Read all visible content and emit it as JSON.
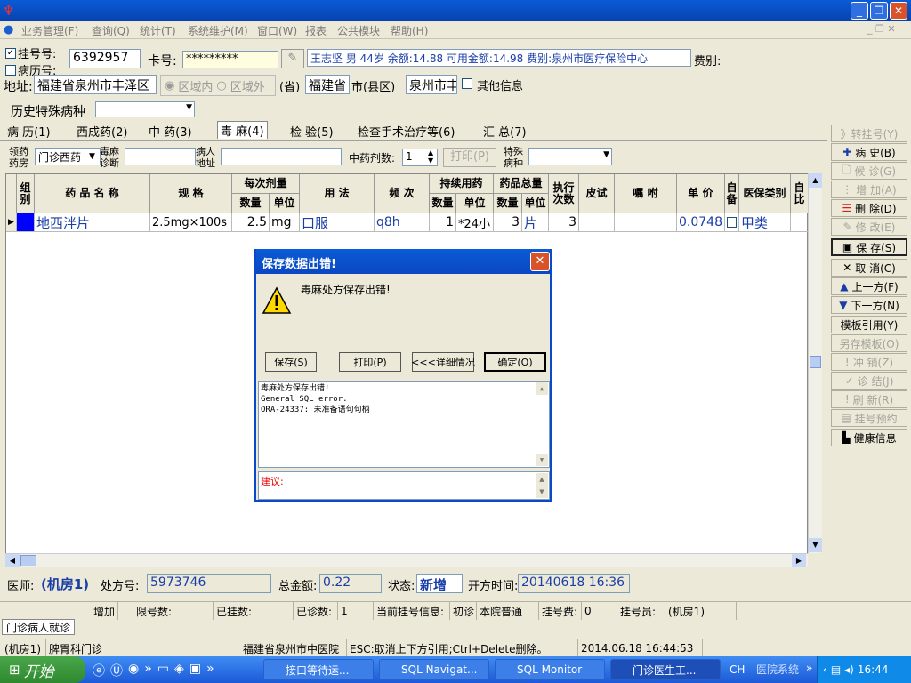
{
  "window": {
    "minimize": "_",
    "restore": "❐",
    "close": "✕"
  },
  "menu": [
    "业务管理(F)",
    "查询(Q)",
    "统计(T)",
    "系统维护(M)",
    "窗口(W)",
    "报表",
    "公共模块",
    "帮助(H)"
  ],
  "patient": {
    "reg_label": "挂号号:",
    "record_label": "病历号:",
    "reg_value": "6392957",
    "card_label": "卡号:",
    "card_value": "*********",
    "info": "王志坚 男 44岁 余额:14.88 可用金额:14.98 费别:泉州市医疗保险中心",
    "fee_type_label": "费别:",
    "addr_label": "地址:",
    "addr_value": "福建省泉州市丰泽区",
    "region_in": "区域内",
    "region_out": "区域外",
    "province_value": "福建省",
    "province_label": "(省)",
    "city_value": "泉州市丰",
    "city_label": "市(县区)",
    "other_info": "其他信息",
    "history_label": "历史特殊病种"
  },
  "tabs": [
    "病 历(1)",
    "西成药(2)",
    "中 药(3)",
    "毒 麻(4)",
    "检 验(5)",
    "检查手术治疗等(6)",
    "汇 总(7)"
  ],
  "rx_header": {
    "pharmacy_label": "领药药房",
    "pharmacy_value": "门诊西药",
    "diag_label": "毒麻诊断",
    "patient_addr_label": "病人地址",
    "herb_doses_label": "中药剂数:",
    "herb_doses_value": "1",
    "print_btn": "打印(P)",
    "special_label": "特殊病种"
  },
  "grid": {
    "headers": {
      "group": "组别",
      "name": "药 品 名 称",
      "spec": "规 格",
      "per_dose": "每次剂量",
      "qty": "数量",
      "unit": "单位",
      "usage": "用 法",
      "freq": "频 次",
      "duration": "持续用药",
      "total": "药品总量",
      "exec": "执行次数",
      "skin": "皮试",
      "note": "嘱 咐",
      "price": "单 价",
      "self": "自备",
      "ins_type": "医保类别",
      "ratio": "自比"
    },
    "row": {
      "name": "地西泮片",
      "spec": "2.5mg×100s",
      "dose_qty": "2.5",
      "dose_unit": "mg",
      "usage": "口服",
      "freq": "q8h",
      "dur_qty": "1",
      "dur_unit": "*24小",
      "total_qty": "3",
      "total_unit": "片",
      "exec": "3",
      "price": "0.0748",
      "ins_type": "甲类"
    }
  },
  "side_buttons": [
    "转挂号(Y)",
    "病 史(B)",
    "候 诊(G)",
    "增 加(A)",
    "删 除(D)",
    "修 改(E)",
    "保 存(S)",
    "取 消(C)",
    "上一方(F)",
    "下一方(N)",
    "模板引用(Y)",
    "另存模板(O)",
    "冲 销(Z)",
    "诊 结(J)",
    "刷 新(R)",
    "挂号预约",
    "健康信息"
  ],
  "dialog": {
    "title": "保存数据出错!",
    "message": "毒麻处方保存出错!",
    "btn_save": "保存(S)",
    "btn_print": "打印(P)",
    "btn_detail": "<<<详细情况",
    "btn_ok": "确定(O)",
    "detail_line1": "毒麻处方保存出错!",
    "detail_line2": "General SQL error.",
    "detail_line3": "ORA-24337: 未准备语句句柄",
    "suggest_label": "建议:"
  },
  "footer": {
    "doctor_label": "医师:",
    "doctor_value": "(机房1)",
    "rx_no_label": "处方号:",
    "rx_no_value": "5973746",
    "total_label": "总金额:",
    "total_value": "0.22",
    "status_label": "状态:",
    "status_value": "新增",
    "time_label": "开方时间:",
    "time_value": "20140618 16:36"
  },
  "infobar": {
    "add": "增加",
    "limit": "限号数:",
    "registered": "已挂数:",
    "diagnosed": "已诊数:",
    "diagnosed_value": "1",
    "current": "当前挂号信息:",
    "visit": "初诊",
    "hospital": "本院普通",
    "fee": "挂号费:",
    "fee_value": "0",
    "registrar": "挂号员:",
    "registrar_value": "(机房1)"
  },
  "visit_tab": "门诊病人就诊",
  "statusbar": {
    "user": "(机房1)",
    "dept": "脾胃科门诊",
    "hospital": "福建省泉州市中医院",
    "hint": "ESC:取消上下方引用;Ctrl+Delete删除。",
    "datetime": "2014.06.18 16:44:53"
  },
  "taskbar": {
    "start": "开始",
    "tasks": [
      "接口等待运...",
      "SQL Navigat...",
      "SQL Monitor",
      "门诊医生工..."
    ],
    "lang": "CH",
    "sys": "医院系统",
    "clock": "16:44"
  }
}
